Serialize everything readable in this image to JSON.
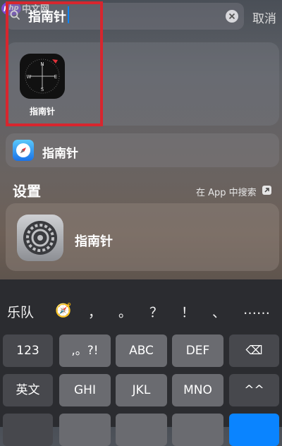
{
  "watermark": {
    "logo": "php",
    "text": "中文网"
  },
  "search": {
    "query": "指南针",
    "cancel_label": "取消"
  },
  "top_hits": [
    {
      "label": "指南针",
      "icon": "compass-icon"
    }
  ],
  "suggestion": {
    "label": "指南针",
    "icon": "safari-icon"
  },
  "settings_section": {
    "title": "设置",
    "search_in_app_label": "在 App 中搜索",
    "result": {
      "label": "指南针",
      "icon": "settings-icon"
    }
  },
  "keyboard": {
    "candidates": [
      "乐队",
      "🧭",
      "，",
      "。",
      "？",
      "！",
      "、",
      "……"
    ],
    "row1": [
      "123",
      ",。?!",
      "ABC",
      "DEF",
      "⌫"
    ],
    "row2": [
      "英文",
      "GHI",
      "JKL",
      "MNO",
      "^^"
    ]
  },
  "colors": {
    "highlight_box": "#d7262e",
    "caret": "#0a84ff"
  }
}
